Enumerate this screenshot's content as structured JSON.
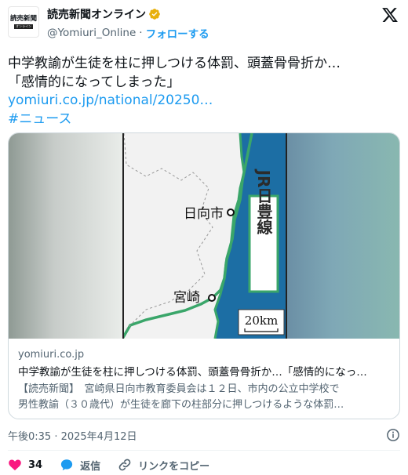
{
  "account": {
    "display_name": "読売新聞オンライン",
    "handle": "@Yomiuri_Online",
    "separator": "·",
    "follow_label": "フォローする",
    "avatar_text": "読売新聞",
    "avatar_subtext": "オンライン",
    "verified_color": "#e8b00a"
  },
  "tweet": {
    "text_line1": "中学教諭が生徒を柱に押しつける体罰、頭蓋骨骨折か…",
    "text_line2": "「感情的になってしまった」",
    "link": "yomiuri.co.jp/national/20250…",
    "hashtag": "#ニュース"
  },
  "card": {
    "map": {
      "city1": "日向市",
      "city2": "宮崎",
      "railway": "JR日豊線",
      "scale": "20km",
      "sea_color": "#1c6ea4",
      "land_color": "#f2f2f2",
      "rail_color": "#3aa66a"
    },
    "domain": "yomiuri.co.jp",
    "title": "中学教諭が生徒を柱に押しつける体罰、頭蓋骨骨折か…「感情的になっ…",
    "desc_line1": "【読売新聞】　宮崎県日向市教育委員会は１２日、市内の公立中学校で",
    "desc_line2": "男性教諭（３０歳代）が生徒を廊下の柱部分に押しつけるような体罰…"
  },
  "timestamp": "午後0:35 · 2025年4月12日",
  "actions": {
    "like_count": "34",
    "reply_label": "返信",
    "copy_link_label": "リンクをコピー",
    "like_color": "#f91880",
    "reply_color": "#1d9bf0"
  }
}
